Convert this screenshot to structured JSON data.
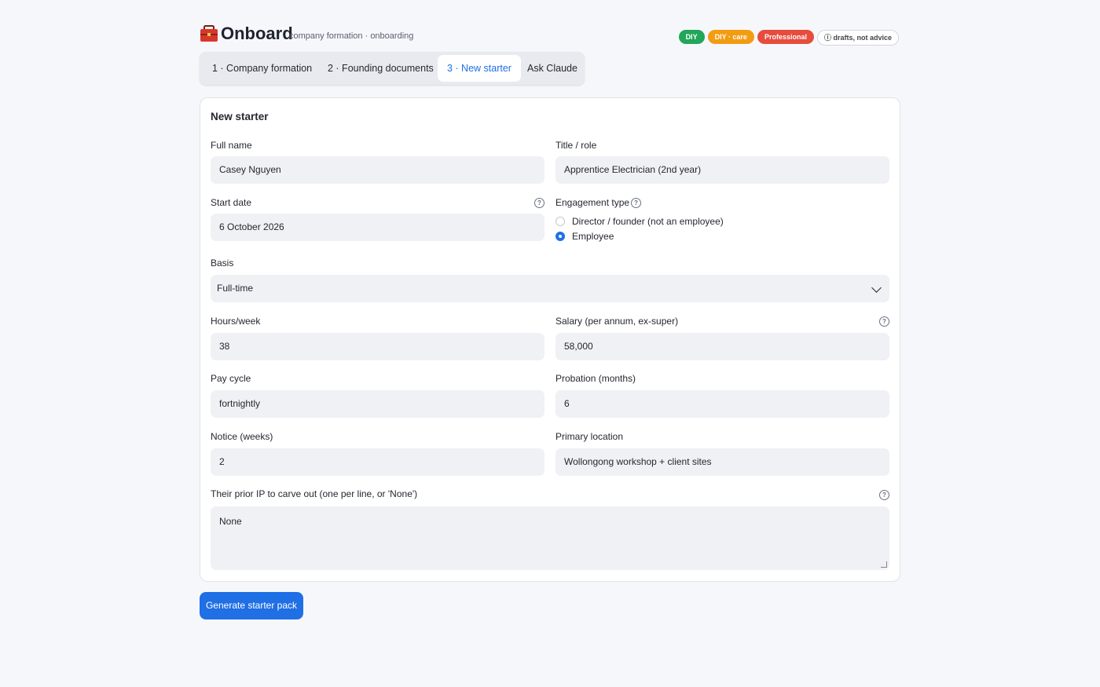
{
  "header": {
    "title": "Onboard",
    "subtitle": "company formation · onboarding",
    "badges": {
      "diy": "DIY",
      "diy_care": "DIY · care",
      "professional": "Professional",
      "note": "ⓘ drafts, not advice"
    },
    "logo_icon": "toolbox-icon"
  },
  "tabs": [
    {
      "label": "1 · Company formation"
    },
    {
      "label": "2 · Founding documents"
    },
    {
      "label": "3 · New starter",
      "active": true
    },
    {
      "label": "Ask Claude"
    }
  ],
  "form": {
    "title": "New starter",
    "full_name": {
      "label": "Full name",
      "value": "Casey Nguyen"
    },
    "title_role": {
      "label": "Title / role",
      "value": "Apprentice Electrician (2nd year)"
    },
    "start_date": {
      "label": "Start date",
      "value": "6 October 2026"
    },
    "engagement_type": {
      "label": "Engagement type",
      "options": [
        "Director / founder (not an employee)",
        "Employee"
      ],
      "selected": "Employee"
    },
    "basis": {
      "label": "Basis",
      "value": "Full-time"
    },
    "hours_week": {
      "label": "Hours/week",
      "value": "38"
    },
    "salary": {
      "label": "Salary (per annum, ex-super)",
      "value": "58,000"
    },
    "pay_cycle": {
      "label": "Pay cycle",
      "value": "fortnightly"
    },
    "probation": {
      "label": "Probation (months)",
      "value": "6"
    },
    "notice": {
      "label": "Notice (weeks)",
      "value": "2"
    },
    "primary_location": {
      "label": "Primary location",
      "value": "Wollongong workshop + client sites"
    },
    "prior_ip": {
      "label": "Their prior IP to carve out (one per line, or 'None')",
      "value": "None"
    }
  },
  "actions": {
    "generate": "Generate starter pack"
  },
  "colors": {
    "accent": "#1f6fe5",
    "diy": "#21a65a",
    "diy_care": "#f39c12",
    "professional": "#e74c3c"
  }
}
